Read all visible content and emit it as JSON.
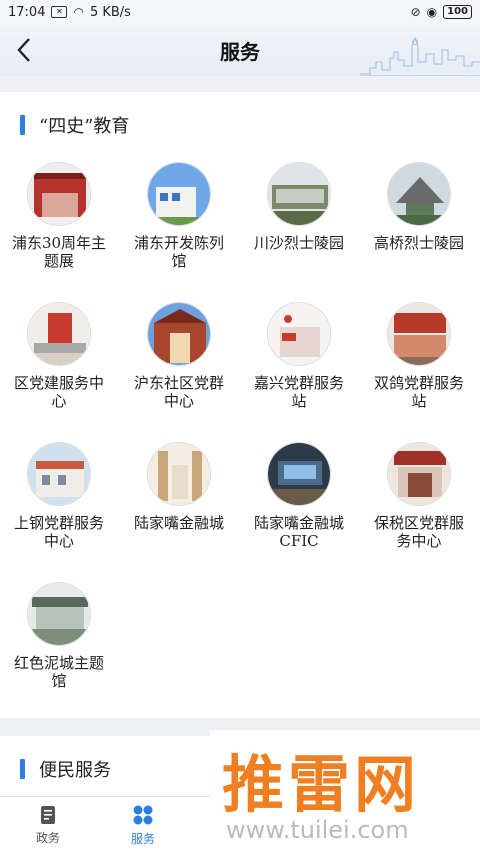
{
  "status_bar": {
    "time": "17:04",
    "speed": "5 KB/s",
    "battery": "100",
    "icons": [
      "notification-x-icon",
      "wifi-icon",
      "mute-icon",
      "alarm-icon",
      "battery-icon"
    ]
  },
  "header": {
    "title": "服务",
    "back_icon": "chevron-left-icon"
  },
  "education": {
    "title": "“四史”教育",
    "items": [
      {
        "label": "浦东30周年主题展",
        "thumb_color": "#b5332a"
      },
      {
        "label": "浦东开发陈列馆",
        "thumb_color": "#3a76c4"
      },
      {
        "label": "川沙烈士陵园",
        "thumb_color": "#7a8b6a"
      },
      {
        "label": "高桥烈士陵园",
        "thumb_color": "#5d7a58"
      },
      {
        "label": "区党建服务中心",
        "thumb_color": "#c73a2e"
      },
      {
        "label": "沪东社区党群中心",
        "thumb_color": "#a8452d"
      },
      {
        "label": "嘉兴党群服务站",
        "thumb_color": "#e7d6cf"
      },
      {
        "label": "双鸽党群服务站",
        "thumb_color": "#b63a2a"
      },
      {
        "label": "上钢党群服务中心",
        "thumb_color": "#c95a3f"
      },
      {
        "label": "陆家嘴金融城",
        "thumb_color": "#c9a77a"
      },
      {
        "label": "陆家嘴金融城CFIC",
        "thumb_color": "#4d6b8a"
      },
      {
        "label": "保税区党群服务中心",
        "thumb_color": "#a0302a"
      },
      {
        "label": "红色泥城主题馆",
        "thumb_color": "#7d8f7a"
      }
    ]
  },
  "services": {
    "title": "便民服务"
  },
  "tabbar": {
    "tabs": [
      {
        "label": "政务",
        "icon": "document-icon"
      },
      {
        "label": "服务",
        "icon": "grid-icon"
      }
    ],
    "active_color": "#2f7de1"
  },
  "watermark": {
    "text": "推雷网",
    "url": "www.tuilei.com"
  }
}
